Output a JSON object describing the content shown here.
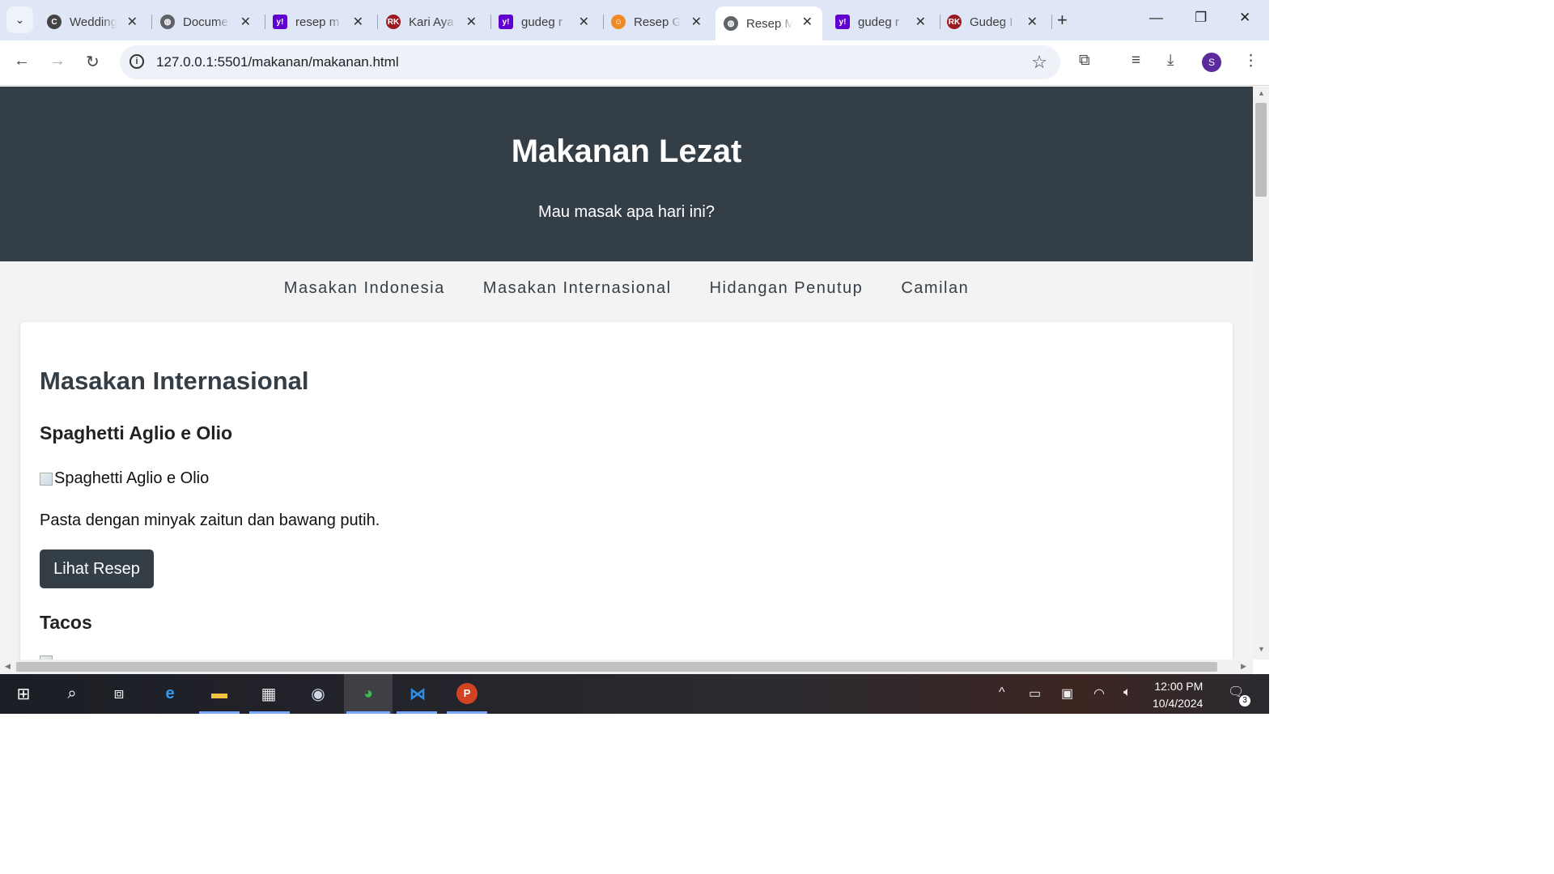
{
  "browser": {
    "tabs": [
      {
        "title": "Wedding",
        "favicon": "cms-icon",
        "color": "#ffffff"
      },
      {
        "title": "Document",
        "favicon": "globe-icon",
        "color": "#5f6368"
      },
      {
        "title": "resep m",
        "favicon": "yahoo-icon",
        "color": "#6001d2"
      },
      {
        "title": "Kari Aya",
        "favicon": "rk-icon",
        "color": "#9b1b22"
      },
      {
        "title": "gudeg r",
        "favicon": "yahoo-icon",
        "color": "#6001d2"
      },
      {
        "title": "Resep G",
        "favicon": "chef-icon",
        "color": "#f08a24"
      },
      {
        "title": "Resep M",
        "favicon": "globe-icon",
        "color": "#5f6368",
        "active": true
      },
      {
        "title": "gudeg r",
        "favicon": "yahoo-icon",
        "color": "#6001d2"
      },
      {
        "title": "Gudeg I",
        "favicon": "rk-icon",
        "color": "#9b1b22"
      }
    ],
    "url": "127.0.0.1:5501/makanan/makanan.html",
    "profile_initial": "S"
  },
  "page": {
    "site_title": "Makanan Lezat",
    "tagline": "Mau masak apa hari ini?",
    "nav": [
      "Masakan Indonesia",
      "Masakan Internasional",
      "Hidangan Penutup",
      "Camilan"
    ],
    "section_title": "Masakan Internasional",
    "dishes": [
      {
        "name": "Spaghetti Aglio e Olio",
        "image_alt": "Spaghetti Aglio e Olio",
        "description": "Pasta dengan minyak zaitun dan bawang putih.",
        "button": "Lihat Resep"
      },
      {
        "name": "Tacos"
      }
    ],
    "colors": {
      "header_bg": "#343e47",
      "button_bg": "#343e47",
      "page_bg": "#f3f3f3"
    }
  },
  "taskbar": {
    "time": "12:00 PM",
    "date": "10/4/2024",
    "notifications": "3"
  }
}
